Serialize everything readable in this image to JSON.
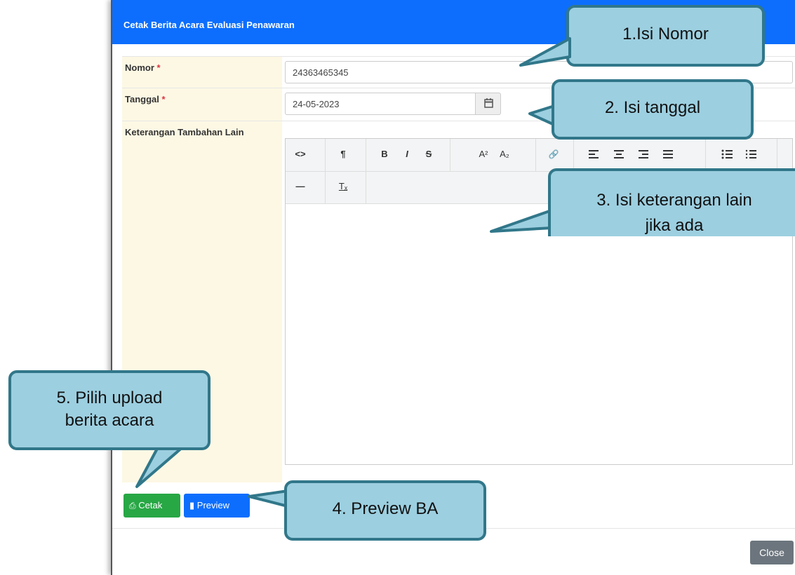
{
  "modal": {
    "title": "Cetak Berita Acara Evaluasi Penawaran",
    "close_label": "Close"
  },
  "form": {
    "nomor": {
      "label": "Nomor",
      "required_mark": "*",
      "value": "24363465345"
    },
    "tanggal": {
      "label": "Tanggal",
      "required_mark": "*",
      "value": "24-05-2023"
    },
    "keterangan": {
      "label": "Keterangan Tambahan Lain"
    }
  },
  "toolbar": {
    "row1": [
      "code-view",
      "paragraph-format",
      "bold",
      "italic",
      "strikethrough",
      "superscript",
      "subscript",
      "insert-link",
      "align-left",
      "align-center",
      "align-right",
      "align-justify",
      "unordered-list",
      "ordered-list"
    ],
    "row2": [
      "horizontal-line",
      "clear-formatting"
    ],
    "glyphs": {
      "code": "<>",
      "paragraph": "¶",
      "bold": "B",
      "italic": "I",
      "strike": "S",
      "sup": "A²",
      "sub": "A₂",
      "link": "🔗",
      "hr": "—",
      "clear": "Tₓ"
    }
  },
  "buttons": {
    "cetak": "Cetak",
    "preview": "Preview"
  },
  "callouts": {
    "c1": "1.Isi Nomor",
    "c2": "2. Isi tanggal",
    "c3_line1": "3. Isi keterangan lain",
    "c3_line2": "jika ada",
    "c4": "4. Preview BA",
    "c5_line1": "5. Pilih upload",
    "c5_line2": "berita acara"
  },
  "colors": {
    "header": "#0d6efd",
    "cetak_button": "#28a745",
    "preview_button": "#0d6efd",
    "close_button": "#6c757d",
    "callout_fill": "#9ccfe0",
    "callout_border": "#31778a",
    "label_bg": "#fdf8e4"
  }
}
